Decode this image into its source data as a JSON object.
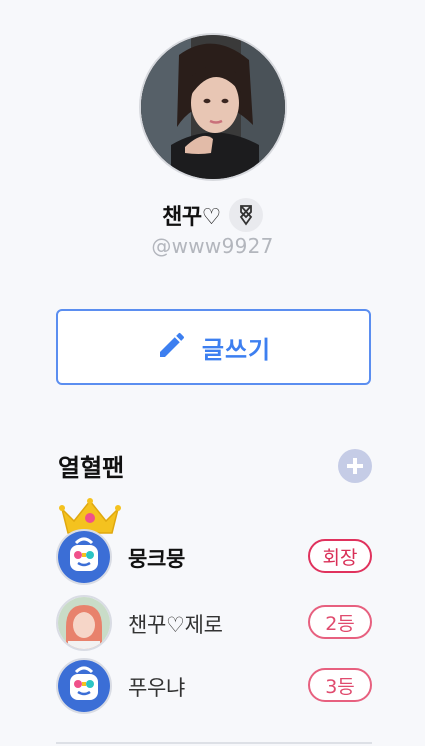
{
  "profile": {
    "name": "챈꾸♡",
    "handle": "@www9927",
    "avatar_icon": "profile-photo",
    "badge_icon": "verified-ribbon-icon"
  },
  "write_button": {
    "label": "글쓰기",
    "icon": "pencil-icon",
    "color": "#3d7ff0"
  },
  "fans": {
    "title": "열혈팬",
    "add_icon": "plus-icon",
    "items": [
      {
        "name": "뭉크뭉",
        "rank": "회장",
        "avatar": "app-mascot-icon",
        "crown": true
      },
      {
        "name": "챈꾸♡제로",
        "rank": "2등",
        "avatar": "user-photo"
      },
      {
        "name": "푸우냐",
        "rank": "3등",
        "avatar": "app-mascot-icon"
      }
    ]
  },
  "colors": {
    "accent": "#3d7ff0",
    "rank_badge": "#e04b6e",
    "background": "#f7f8fb"
  }
}
